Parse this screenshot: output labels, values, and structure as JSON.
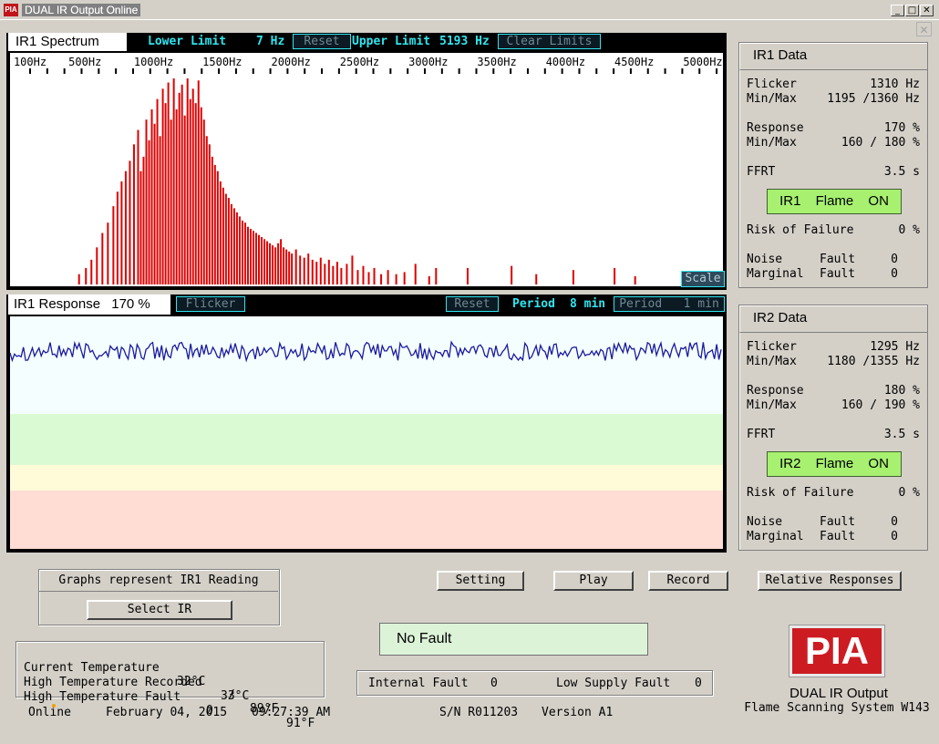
{
  "window": {
    "title": "DUAL IR Output Online",
    "app_icon": "PIA",
    "minimize": "_",
    "maximize": "□",
    "close": "✕",
    "inner_close": "✕"
  },
  "spectrum": {
    "tab": "IR1 Spectrum",
    "lower_limit_label": "Lower Limit",
    "lower_limit_value": "7 Hz",
    "reset": "Reset",
    "upper_limit_label": "Upper Limit",
    "upper_limit_value": "5193 Hz",
    "clear_limits": "Clear Limits",
    "scale": "Scale"
  },
  "response": {
    "tab_label": "IR1 Response",
    "tab_value": "170 %",
    "flicker_btn": "Flicker",
    "reset": "Reset",
    "period_label": "Period",
    "period_value": "8 min",
    "period_btn": "Period   1 min"
  },
  "ir1": {
    "header": "IR1 Data",
    "flicker_label": "Flicker",
    "flicker_value": "1310 Hz",
    "flicker_minmax_label": "Min/Max",
    "flicker_minmax_value": "1195 /1360 Hz",
    "response_label": "Response",
    "response_value": "170 %",
    "response_minmax_label": "Min/Max",
    "response_minmax_value": "160 / 180 %",
    "ffrt_label": "FFRT",
    "ffrt_value": "3.5 s",
    "flame": "IR1 Flame ON",
    "risk_label": "Risk of Failure",
    "risk_value": "0 %",
    "noise_label": "Noise",
    "noise_fault_label": "Fault",
    "noise_value": "0",
    "marginal_label": "Marginal",
    "marginal_fault_label": "Fault",
    "marginal_value": "0"
  },
  "ir2": {
    "header": "IR2 Data",
    "flicker_label": "Flicker",
    "flicker_value": "1295 Hz",
    "flicker_minmax_label": "Min/Max",
    "flicker_minmax_value": "1180 /1355 Hz",
    "response_label": "Response",
    "response_value": "180 %",
    "response_minmax_label": "Min/Max",
    "response_minmax_value": "160 / 190 %",
    "ffrt_label": "FFRT",
    "ffrt_value": "3.5 s",
    "flame": "IR2 Flame ON",
    "risk_label": "Risk of Failure",
    "risk_value": "0 %",
    "noise_label": "Noise",
    "noise_fault_label": "Fault",
    "noise_value": "0",
    "marginal_label": "Marginal",
    "marginal_fault_label": "Fault",
    "marginal_value": "0"
  },
  "controls": {
    "graphs_represent": "Graphs represent IR1 Reading",
    "select_ir": "Select IR",
    "setting": "Setting",
    "play": "Play",
    "record": "Record",
    "relative_responses": "Relative Responses",
    "fault_status": "No Fault"
  },
  "temps": {
    "current_label": "Current Temperature",
    "current_c": "32°C",
    "current_sep": "/",
    "current_f": "89°F",
    "high_label": "High Temperature Recorded",
    "high_c": "33°C",
    "high_sep": "/",
    "high_f": "91°F",
    "fault_label": "High Temperature Fault",
    "fault_value": "0"
  },
  "faults": {
    "internal_label": "Internal Fault",
    "internal_value": "0",
    "low_supply_label": "Low Supply Fault",
    "low_supply_value": "0"
  },
  "brand": {
    "logo": "PIA",
    "product": "DUAL IR Output",
    "system": "Flame Scanning System W143"
  },
  "status_bar": {
    "state": "Online",
    "date": "February 04, 2015",
    "time": "09:27:39 AM",
    "serial": "S/N R011203",
    "version": "Version A1"
  },
  "colors": {
    "spectrum_bars": "#e00000",
    "response_line": "#1a1aa0",
    "flame_on": "#a8f070",
    "accent_cyan": "#2ee6f0"
  },
  "chart_data": [
    {
      "type": "bar",
      "name": "IR1 Spectrum",
      "x_unit": "Hz",
      "xlim": [
        0,
        5193
      ],
      "tick_labels": [
        "100Hz",
        "500Hz",
        "1000Hz",
        "1500Hz",
        "2000Hz",
        "2500Hz",
        "3000Hz",
        "3500Hz",
        "4000Hz",
        "4500Hz",
        "5000Hz"
      ],
      "tick_values": [
        100,
        500,
        1000,
        1500,
        2000,
        2500,
        3000,
        3500,
        4000,
        4500,
        5000
      ],
      "ylim": [
        0,
        1
      ],
      "bars": [
        [
          450,
          0.05
        ],
        [
          500,
          0.08
        ],
        [
          540,
          0.12
        ],
        [
          580,
          0.18
        ],
        [
          620,
          0.25
        ],
        [
          660,
          0.3
        ],
        [
          700,
          0.38
        ],
        [
          730,
          0.45
        ],
        [
          760,
          0.5
        ],
        [
          790,
          0.55
        ],
        [
          820,
          0.6
        ],
        [
          850,
          0.68
        ],
        [
          880,
          0.75
        ],
        [
          900,
          0.55
        ],
        [
          920,
          0.62
        ],
        [
          940,
          0.8
        ],
        [
          960,
          0.7
        ],
        [
          980,
          0.85
        ],
        [
          1000,
          0.78
        ],
        [
          1020,
          0.9
        ],
        [
          1040,
          0.72
        ],
        [
          1060,
          0.95
        ],
        [
          1080,
          0.88
        ],
        [
          1100,
          0.98
        ],
        [
          1120,
          0.8
        ],
        [
          1140,
          1.0
        ],
        [
          1160,
          0.85
        ],
        [
          1180,
          0.93
        ],
        [
          1200,
          0.97
        ],
        [
          1220,
          0.82
        ],
        [
          1240,
          1.0
        ],
        [
          1260,
          0.9
        ],
        [
          1280,
          0.95
        ],
        [
          1300,
          0.88
        ],
        [
          1320,
          0.99
        ],
        [
          1340,
          0.86
        ],
        [
          1360,
          0.8
        ],
        [
          1380,
          0.72
        ],
        [
          1400,
          0.68
        ],
        [
          1420,
          0.62
        ],
        [
          1440,
          0.58
        ],
        [
          1460,
          0.55
        ],
        [
          1480,
          0.5
        ],
        [
          1500,
          0.47
        ],
        [
          1520,
          0.44
        ],
        [
          1540,
          0.42
        ],
        [
          1560,
          0.39
        ],
        [
          1580,
          0.37
        ],
        [
          1600,
          0.35
        ],
        [
          1620,
          0.33
        ],
        [
          1640,
          0.31
        ],
        [
          1660,
          0.3
        ],
        [
          1680,
          0.28
        ],
        [
          1700,
          0.27
        ],
        [
          1720,
          0.26
        ],
        [
          1740,
          0.25
        ],
        [
          1760,
          0.24
        ],
        [
          1780,
          0.23
        ],
        [
          1800,
          0.22
        ],
        [
          1820,
          0.21
        ],
        [
          1840,
          0.2
        ],
        [
          1860,
          0.19
        ],
        [
          1880,
          0.18
        ],
        [
          1900,
          0.2
        ],
        [
          1920,
          0.22
        ],
        [
          1940,
          0.18
        ],
        [
          1960,
          0.17
        ],
        [
          1980,
          0.16
        ],
        [
          2000,
          0.15
        ],
        [
          2030,
          0.17
        ],
        [
          2060,
          0.14
        ],
        [
          2090,
          0.13
        ],
        [
          2120,
          0.15
        ],
        [
          2150,
          0.12
        ],
        [
          2180,
          0.11
        ],
        [
          2210,
          0.13
        ],
        [
          2240,
          0.1
        ],
        [
          2270,
          0.12
        ],
        [
          2300,
          0.09
        ],
        [
          2330,
          0.11
        ],
        [
          2360,
          0.08
        ],
        [
          2400,
          0.1
        ],
        [
          2440,
          0.14
        ],
        [
          2480,
          0.07
        ],
        [
          2520,
          0.09
        ],
        [
          2560,
          0.06
        ],
        [
          2600,
          0.08
        ],
        [
          2650,
          0.05
        ],
        [
          2700,
          0.07
        ],
        [
          2760,
          0.05
        ],
        [
          2820,
          0.06
        ],
        [
          2900,
          0.1
        ],
        [
          3000,
          0.04
        ],
        [
          3050,
          0.08
        ],
        [
          3280,
          0.08
        ],
        [
          3600,
          0.09
        ],
        [
          3780,
          0.05
        ],
        [
          4050,
          0.07
        ],
        [
          4350,
          0.08
        ],
        [
          4500,
          0.04
        ],
        [
          4900,
          0.04
        ]
      ]
    },
    {
      "type": "line",
      "name": "IR1 Response",
      "y_unit": "%",
      "period": "8 min",
      "ylim": [
        0,
        200
      ],
      "bands": [
        {
          "name": "green",
          "from": 60,
          "to": 100
        },
        {
          "name": "yellow",
          "from": 40,
          "to": 60
        },
        {
          "name": "red",
          "from": 0,
          "to": 40
        }
      ],
      "level": 170,
      "jitter": 8,
      "samples": 320
    }
  ]
}
